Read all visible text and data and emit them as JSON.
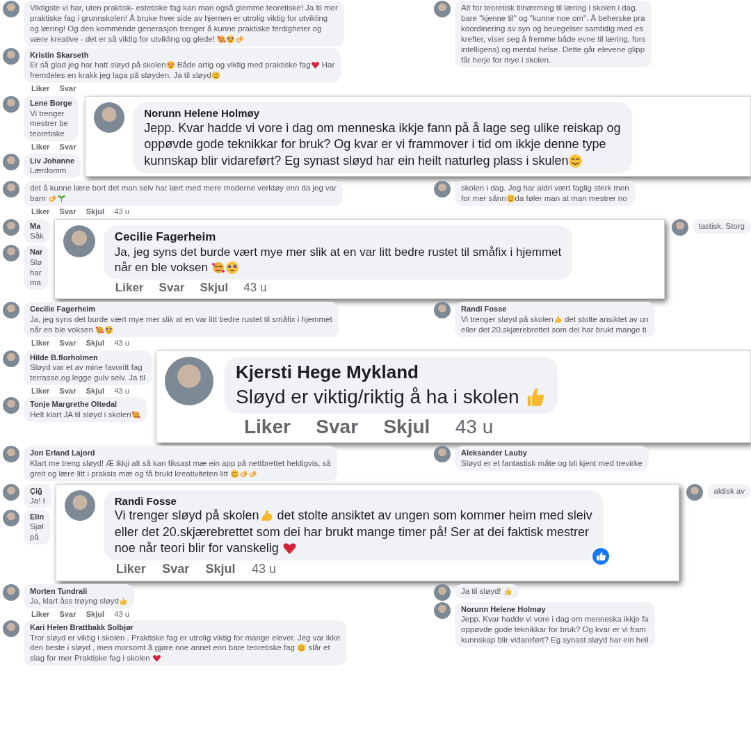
{
  "sections": [
    {
      "kind": "columns",
      "left": [
        {
          "lines": [
            [
              "Viktigste vi har, uten praktisk- estetiske fag kan man også glemme teoretiske! Ja til mer"
            ],
            [
              "praktiske fag i grunnskolen! Å bruke hver side av hjernen er utrolig viktig for utvikling"
            ],
            [
              "og læring! Og den kommende generasjon trenger å kunne praktiske ferdigheter og"
            ],
            [
              "være kreative - det er så viktig for utvikling og glede! ",
              {
                "kind": "hearts-face"
              },
              {
                "kind": "star-eyes"
              },
              {
                "kind": "ok-hand"
              }
            ]
          ]
        },
        {
          "name": "Kristin Skarseth",
          "lines": [
            [
              "Er så glad jeg har hatt sløyd på skolen",
              {
                "kind": "heart-eyes"
              },
              " Både artig og viktig med praktiske fag",
              {
                "kind": "heart"
              },
              " Har"
            ],
            [
              "fremdeles en krakk jeg laga på sløyden. Ja til sløyd",
              {
                "kind": "smile"
              }
            ]
          ],
          "actions": [
            "Liker",
            "Svar"
          ]
        }
      ],
      "right": [
        {
          "lines": [
            [
              "Alt for teoretisk tilnærming til læring i skolen i dag."
            ],
            [
              "bare \"kjenne til\" og \"kunne noe om\". Å beherske pra"
            ],
            [
              "koordinering av syn og bevegelser samtidig med es"
            ],
            [
              "krefter, viser seg å fremme både evne til læring, fors"
            ],
            [
              "intelligens) og mental helse. Dette går elevene glipp"
            ],
            [
              "får herje for mye i skolen."
            ]
          ]
        }
      ]
    },
    {
      "kind": "featured",
      "left": [
        {
          "name": "Lene Borge",
          "lines": [
            [
              "Vi trenger"
            ],
            [
              "mestrer be"
            ],
            [
              "teoretiske"
            ]
          ],
          "actions": [
            "Liker",
            "Svar"
          ]
        },
        {
          "name": "Liv Johanne",
          "lines": [
            [
              "Lærdomm"
            ]
          ]
        }
      ],
      "comment": {
        "name": "Norunn Helene Holmøy",
        "lines": [
          [
            "Jepp. Kvar hadde vi vore i dag om menneska ikkje fann på å lage seg ulike reiskap og"
          ],
          [
            "oppøvde gode teknikkar for bruk? Og kvar er vi frammover i tid om ikkje denne type"
          ],
          [
            "kunnskap blir vidareført? Eg synast sløyd har ein heilt naturleg plass i skulen",
            {
              "kind": "smile"
            }
          ]
        ]
      }
    },
    {
      "kind": "columns",
      "left": [
        {
          "lines": [
            [
              "det å kunne lære bort det man selv har lært med mere moderne verktøy enn da jeg var"
            ],
            [
              "barn ",
              {
                "kind": "ok-hand"
              },
              {
                "kind": "sprout"
              }
            ]
          ],
          "actions": [
            "Liker",
            "Svar",
            "Skjul"
          ],
          "time": "43 u"
        }
      ],
      "right": [
        {
          "lines": [
            [
              "skolen i dag. Jeg har aldri vært faglig sterk men"
            ],
            [
              "for mer sånn",
              {
                "kind": "smile"
              },
              "da føler man at man mestrer no"
            ]
          ]
        }
      ]
    },
    {
      "kind": "featured",
      "left": [
        {
          "name": "Ma",
          "lines": [
            [
              "Såk"
            ]
          ]
        },
        {
          "name": "Nar",
          "lines": [
            [
              "Slø"
            ],
            [
              "har"
            ],
            [
              "ma"
            ]
          ]
        }
      ],
      "comment": {
        "name": "Cecilie Fagerheim",
        "lines": [
          [
            "Ja, jeg syns det burde vært mye mer slik at en var litt bedre rustet til småfix i hjemmet"
          ],
          [
            "når en ble voksen ",
            {
              "kind": "hearts-face"
            },
            {
              "kind": "star-eyes"
            }
          ]
        ],
        "actions": [
          "Liker",
          "Svar",
          "Skjul"
        ],
        "time": "43 u"
      },
      "right": [
        {
          "lines": [
            [
              "tastisk. Storg"
            ]
          ]
        }
      ]
    },
    {
      "kind": "columns",
      "left": [
        {
          "name": "Cecilie Fagerheim",
          "lines": [
            [
              "Ja, jeg syns det burde vært mye mer slik at en var litt bedre rustet til småfix i hjemmet"
            ],
            [
              "når en ble voksen ",
              {
                "kind": "hearts-face"
              },
              {
                "kind": "star-eyes"
              }
            ]
          ],
          "actions": [
            "Liker",
            "Svar",
            "Skjul"
          ],
          "time": "43 u"
        }
      ],
      "right": [
        {
          "name": "Randi Fosse",
          "lines": [
            [
              "Vi trenger sløyd på skolen",
              {
                "kind": "muscle"
              },
              " det stolte ansiktet av un"
            ],
            [
              "eller det 20.skjærebrettet som dei har brukt mange ti"
            ]
          ]
        }
      ]
    },
    {
      "kind": "featured",
      "left": [
        {
          "name": "Hilde B.florholmen",
          "lines": [
            [
              "Sløyd var et av mine favoritt fag"
            ],
            [
              "terrasse,og legge gulv selv. Ja til"
            ]
          ],
          "actions": [
            "Liker",
            "Svar",
            "Skjul"
          ],
          "time": "43 u"
        },
        {
          "name": "Tonje Margrethe Oltedal",
          "lines": [
            [
              "Helt klart JA til sløyd i skolen",
              {
                "kind": "hearts-face"
              }
            ]
          ]
        }
      ],
      "comment": {
        "name": "Kjersti Hege Mykland",
        "lines": [
          [
            "Sløyd er viktig/riktig å ha i skolen ",
            {
              "kind": "thumb"
            }
          ]
        ],
        "actions": [
          "Liker",
          "Svar",
          "Skjul"
        ],
        "time": "43 u"
      }
    },
    {
      "kind": "columns",
      "left": [
        {
          "name": "Jon Erland Lajord",
          "lines": [
            [
              "Klart me treng sløyd! Æ ikkji alt så kan fiksast mæ ein app på nettbrettet heldigvis, så"
            ],
            [
              "greit og lære litt i praksis mæ og få brukt kreativiteten litt ",
              {
                "kind": "smile"
              },
              {
                "kind": "ok-hand"
              },
              {
                "kind": "ok-hand"
              }
            ]
          ]
        }
      ],
      "right": [
        {
          "name": "Aleksander Lauby",
          "lines": [
            [
              "Sløyd er et fantastisk måte og bli kjent med trevirke"
            ]
          ]
        }
      ]
    },
    {
      "kind": "featured",
      "left": [
        {
          "name": "Çiğ",
          "lines": [
            [
              "Ja! I"
            ]
          ]
        },
        {
          "name": "Elin",
          "lines": [
            [
              "Sjøl"
            ],
            [
              "på"
            ]
          ]
        }
      ],
      "comment": {
        "name": "Randi Fosse",
        "lines": [
          [
            "Vi trenger sløyd på skolen",
            {
              "kind": "muscle"
            },
            " det stolte ansiktet av ungen som kommer heim med sleiv"
          ],
          [
            "eller det 20.skjærebrettet som dei har brukt mange timer på! Ser at dei faktisk mestrer"
          ],
          [
            "noe når teori blir for vanskelig ",
            {
              "kind": "heart"
            }
          ]
        ],
        "actions": [
          "Liker",
          "Svar",
          "Skjul"
        ],
        "time": "43 u",
        "liked": true
      },
      "right": [
        {
          "lines": [
            [
              "aktisk av"
            ]
          ]
        }
      ]
    },
    {
      "kind": "columns",
      "left": [
        {
          "name": "Morten Tundrali",
          "lines": [
            [
              "Ja, klart åss trøyng sløyd",
              {
                "kind": "thumb"
              }
            ]
          ],
          "actions": [
            "Liker",
            "Svar",
            "Skjul"
          ],
          "time": "43 u"
        },
        {
          "name": "Kari Helen Brattbakk Solbjør",
          "lines": [
            [
              "Tror sløyd er viktig i skolen . Praktiske fag er utrolig viktig for mange elever. Jeg var ikke"
            ],
            [
              "den beste i sløyd , men morsomt å gjøre noe annet enn bare teoretiske fag ",
              {
                "kind": "smile"
              },
              " slår et"
            ],
            [
              "slag for mer Praktiske fag i skolen ",
              {
                "kind": "heart"
              }
            ]
          ]
        }
      ],
      "right": [
        {
          "lines": [
            [
              "Ja til sløyd! ",
              {
                "kind": "thumb"
              }
            ]
          ]
        },
        {
          "name": "Norunn Helene Holmøy",
          "lines": [
            [
              "Jepp. Kvar hadde vi vore i dag om menneska ikkje fa"
            ],
            [
              "oppøvde gode teknikkar for bruk? Og kvar er vi fram"
            ],
            [
              "kunnskap blir vidareført? Eg synast sløyd har ein heil"
            ]
          ]
        }
      ]
    }
  ]
}
